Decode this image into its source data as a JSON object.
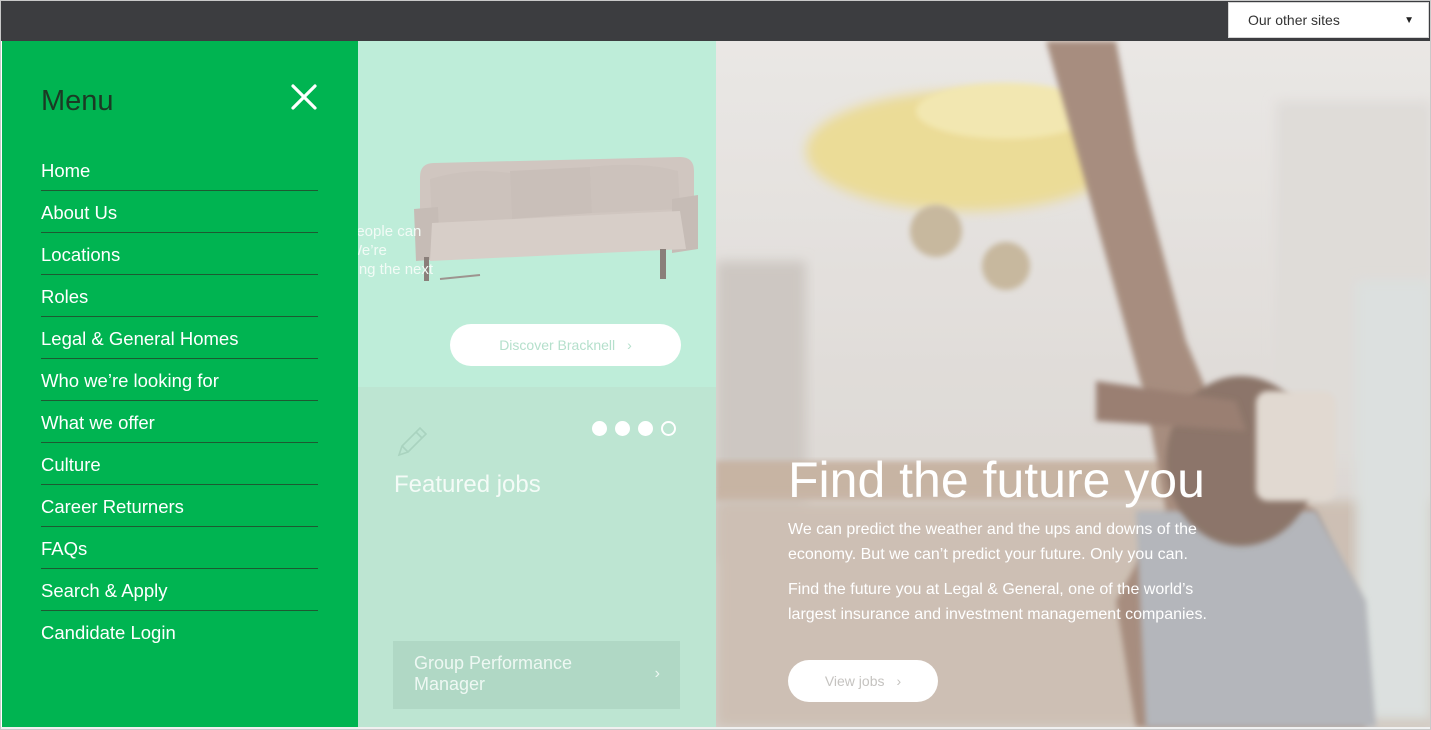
{
  "topbar": {
    "other_sites_label": "Our other sites",
    "caret_icon": "caret-down-icon"
  },
  "menu": {
    "title": "Menu",
    "close_icon": "close-icon",
    "items": [
      {
        "label": "Home"
      },
      {
        "label": "About Us"
      },
      {
        "label": "Locations"
      },
      {
        "label": "Roles"
      },
      {
        "label": "Legal & General Homes"
      },
      {
        "label": "Who we’re looking for"
      },
      {
        "label": "What we offer"
      },
      {
        "label": "Culture"
      },
      {
        "label": "Career Returners"
      },
      {
        "label": "FAQs"
      },
      {
        "label": "Search & Apply"
      },
      {
        "label": "Candidate Login"
      }
    ]
  },
  "location_panel": {
    "partial_text": [
      "people can",
      "We’re",
      "ving the next"
    ],
    "discover_label": "Discover Bracknell",
    "chevron": "›"
  },
  "featured": {
    "title": "Featured jobs",
    "pencil_icon": "pencil-icon",
    "carousel_dots": [
      true,
      true,
      true,
      false
    ],
    "job_title": "Group Performance Manager",
    "chevron": "›"
  },
  "hero": {
    "title": "Find the future you",
    "paragraph1": "We can predict the weather and the ups and downs of the economy. But we can’t predict your future. Only you can.",
    "paragraph2": "Find the future you at Legal & General, one of the world’s largest insurance and investment management companies.",
    "view_jobs_label": "View jobs",
    "chevron": "›"
  },
  "colors": {
    "topbar": "#3c3d40",
    "menu_green": "#00b451",
    "mint": "#beedd9",
    "mint_dark": "#bde5d2"
  }
}
